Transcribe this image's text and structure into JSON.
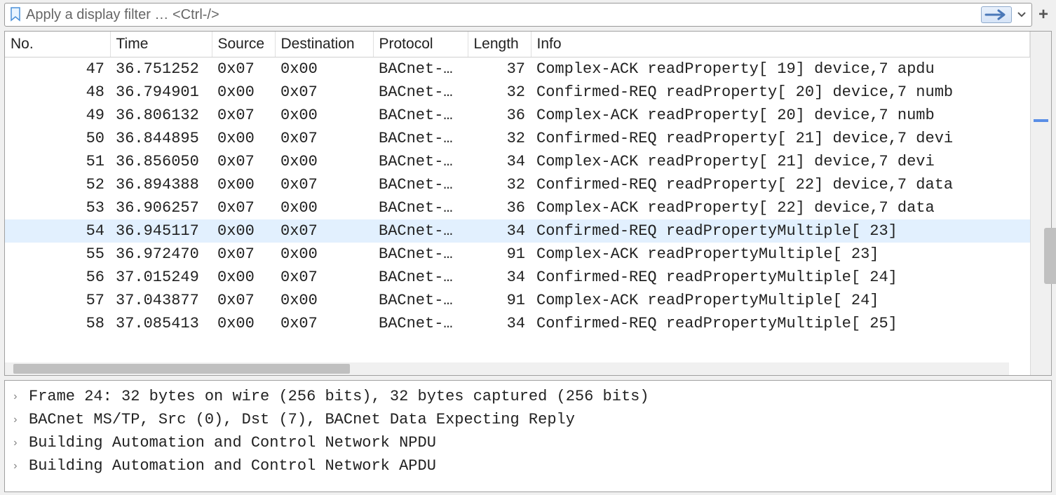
{
  "filter": {
    "placeholder": "Apply a display filter … <Ctrl-/>"
  },
  "columns": {
    "no": "No.",
    "time": "Time",
    "source": "Source",
    "destination": "Destination",
    "protocol": "Protocol",
    "length": "Length",
    "info": "Info"
  },
  "packets": [
    {
      "no": "47",
      "time": "36.751252",
      "src": "0x07",
      "dst": "0x00",
      "proto": "BACnet-…",
      "len": "37",
      "info": "Complex-ACK      readProperty[ 19] device,7 apdu",
      "sel": false
    },
    {
      "no": "48",
      "time": "36.794901",
      "src": "0x00",
      "dst": "0x07",
      "proto": "BACnet-…",
      "len": "32",
      "info": "Confirmed-REQ    readProperty[ 20] device,7 numb",
      "sel": false
    },
    {
      "no": "49",
      "time": "36.806132",
      "src": "0x07",
      "dst": "0x00",
      "proto": "BACnet-…",
      "len": "36",
      "info": "Complex-ACK      readProperty[ 20] device,7 numb",
      "sel": false
    },
    {
      "no": "50",
      "time": "36.844895",
      "src": "0x00",
      "dst": "0x07",
      "proto": "BACnet-…",
      "len": "32",
      "info": "Confirmed-REQ    readProperty[ 21] device,7 devi",
      "sel": false
    },
    {
      "no": "51",
      "time": "36.856050",
      "src": "0x07",
      "dst": "0x00",
      "proto": "BACnet-…",
      "len": "34",
      "info": "Complex-ACK      readProperty[ 21] device,7 devi",
      "sel": false
    },
    {
      "no": "52",
      "time": "36.894388",
      "src": "0x00",
      "dst": "0x07",
      "proto": "BACnet-…",
      "len": "32",
      "info": "Confirmed-REQ    readProperty[ 22] device,7 data",
      "sel": false
    },
    {
      "no": "53",
      "time": "36.906257",
      "src": "0x07",
      "dst": "0x00",
      "proto": "BACnet-…",
      "len": "36",
      "info": "Complex-ACK      readProperty[ 22] device,7 data",
      "sel": false
    },
    {
      "no": "54",
      "time": "36.945117",
      "src": "0x00",
      "dst": "0x07",
      "proto": "BACnet-…",
      "len": "34",
      "info": "Confirmed-REQ    readPropertyMultiple[ 23]",
      "sel": true
    },
    {
      "no": "55",
      "time": "36.972470",
      "src": "0x07",
      "dst": "0x00",
      "proto": "BACnet-…",
      "len": "91",
      "info": "Complex-ACK      readPropertyMultiple[ 23]",
      "sel": false
    },
    {
      "no": "56",
      "time": "37.015249",
      "src": "0x00",
      "dst": "0x07",
      "proto": "BACnet-…",
      "len": "34",
      "info": "Confirmed-REQ    readPropertyMultiple[ 24]",
      "sel": false
    },
    {
      "no": "57",
      "time": "37.043877",
      "src": "0x07",
      "dst": "0x00",
      "proto": "BACnet-…",
      "len": "91",
      "info": "Complex-ACK      readPropertyMultiple[ 24]",
      "sel": false
    },
    {
      "no": "58",
      "time": "37.085413",
      "src": "0x00",
      "dst": "0x07",
      "proto": "BACnet-…",
      "len": "34",
      "info": "Confirmed-REQ    readPropertyMultiple[ 25]",
      "sel": false
    }
  ],
  "details": [
    "Frame 24: 32 bytes on wire (256 bits), 32 bytes captured (256 bits)",
    "BACnet MS/TP, Src (0), Dst (7), BACnet Data Expecting Reply",
    "Building Automation and Control Network NPDU",
    "Building Automation and Control Network APDU"
  ]
}
